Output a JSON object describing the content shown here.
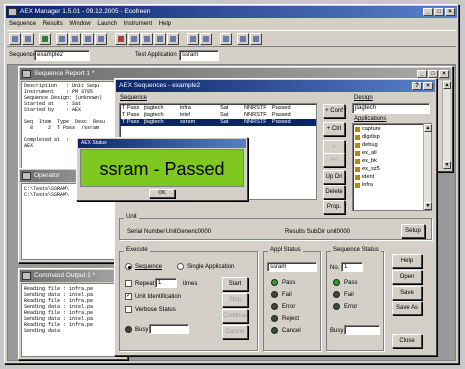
{
  "main_window": {
    "title": "AEX Manager 1.5.01 - 09.12.2005 - Ecofreen",
    "menu": [
      "Sequence",
      "Results",
      "Window",
      "Launch",
      "Instrument",
      "Help"
    ],
    "sequence_label": "Sequence",
    "sequence_value": "example2",
    "test_app_label": "Test Application",
    "test_app_value": "ssram"
  },
  "seq_report": {
    "title": "Sequence Report 1 *",
    "lines": [
      "Description   : Unit Sequ",
      "Instrument    : PM 3705",
      "Sequence Design: (unknown)",
      "Started at    : Sat",
      "Started by    : AEX",
      "",
      "Seq  Item  Type  Desc  Resu",
      "  8     2  T Pass  /ssram",
      "",
      "Completed at  :",
      "AEX"
    ]
  },
  "operator_window": {
    "title": "Operator",
    "lines": [
      "C:\\Tests\\SSRAM\\",
      "C:\\Tests\\SSRAM\\"
    ]
  },
  "cmd_output": {
    "title": "Command Output 1 *",
    "lines": [
      "Reading file : infra.pe",
      "Sending data : intel.pa",
      "Reading file : infra.pe",
      "Sending data : intel.pa",
      "Reading file : infra.pe",
      "Sending data : intel.pa",
      "Reading file : infra.pe",
      "Sending data"
    ]
  },
  "aex_dialog": {
    "title": "AEX Sequences - example2",
    "sequence_label": "Sequence",
    "rows": [
      {
        "t": "T Pass",
        "dev": "jtagtech",
        "name": "infra",
        "date": "Sat",
        "cnt": "NNRSTF",
        "res": "Passed"
      },
      {
        "t": "T Pass",
        "dev": "jtagtech",
        "name": "intel",
        "date": "Sat",
        "cnt": "NNRSTF",
        "res": "Passed"
      },
      {
        "t": "T Pass",
        "dev": "jtagtech",
        "name": "ssram",
        "date": "Sat",
        "cnt": "NNRSTF",
        "res": "Passed"
      }
    ],
    "mid_buttons": [
      "+ Conf",
      "+ Ctrl",
      ">",
      "<<",
      "Up Dn",
      "Delete",
      "Prop."
    ],
    "design_label": "Design",
    "design_value": "jtagtech",
    "applications_label": "Applications",
    "applications": [
      "capture",
      "dlgdisp",
      "debug",
      "ex_all",
      "ex_bk",
      "ex_sz5",
      "ident",
      "infra"
    ],
    "unit_label": "Unit",
    "serial_label": "Serial Number",
    "serial_value": "UnitGeneric0000",
    "results_label": "Results SubDir",
    "results_value": "unit0000",
    "setup_button": "Setup",
    "execute_label": "Execute",
    "sequence_radio": "Sequence",
    "single_app_radio": "Single Application",
    "repeat_label": "Repeat",
    "repeat_value": "1",
    "times_label": "times",
    "unit_id_label": "Unit Identification",
    "verbose_label": "Verbose Status",
    "busy_label": "Busy",
    "start_button": "Start",
    "stop_button": "Stop",
    "continue_button": "Continue",
    "cancel_button": "Cancel",
    "appl_status_label": "Appl Status",
    "appl_status_value": "ssram",
    "appl_leds": [
      "Pass",
      "Fail",
      "Error",
      "Reject",
      "Cancel"
    ],
    "seq_status_label": "Sequence Status",
    "no_label": "No.",
    "no_value": "1",
    "seq_leds": [
      "Pass",
      "Fail",
      "Error"
    ],
    "right_buttons": [
      "Help",
      "Open",
      "Save",
      "Save As"
    ],
    "close_button": "Close"
  },
  "popup": {
    "title": "AEX Status",
    "message": "ssram - Passed",
    "ok_button": "OK",
    "color": "#7ec820"
  }
}
